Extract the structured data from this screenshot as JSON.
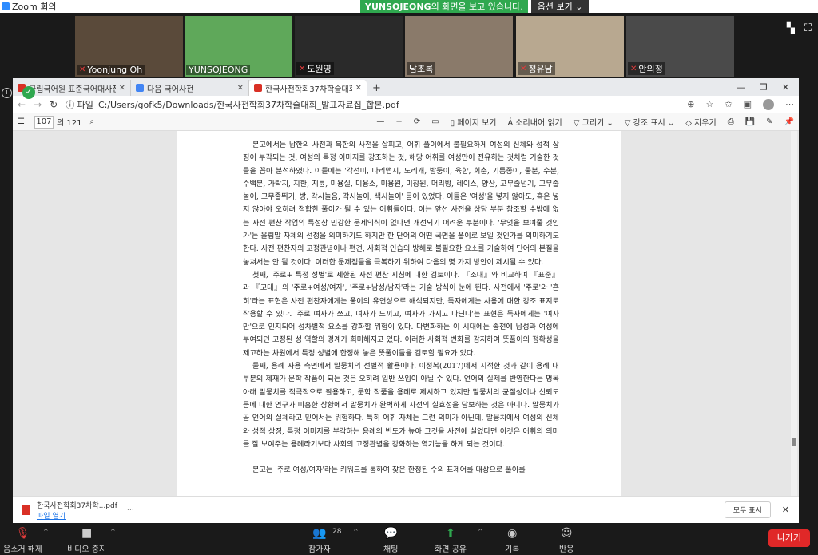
{
  "zoom_window": {
    "title": "Zoom 회의"
  },
  "share_banner": {
    "sharer": "YUNSOJEONG",
    "suffix": "의 화면을 보고 있습니다.",
    "view_options": "옵션 보기 ⌄"
  },
  "participants": [
    {
      "name": "Yoonjung Oh",
      "muted": true,
      "bg": "#5a4a3a"
    },
    {
      "name": "YUNSOJEONG",
      "muted": false,
      "bg": "#5fa85a"
    },
    {
      "name": "도원영",
      "muted": true,
      "bg": "#2a2a2a"
    },
    {
      "name": "남초록",
      "muted": false,
      "bg": "#8a7a6a"
    },
    {
      "name": "정유남",
      "muted": true,
      "bg": "#b8a890"
    },
    {
      "name": "안의정",
      "muted": true,
      "bg": "#4a4a4a"
    }
  ],
  "browser": {
    "tabs": [
      {
        "label": "국립국어원 표준국어대사전",
        "favicon_color": "#d93025"
      },
      {
        "label": "다음 국어사전",
        "favicon_color": "#4285f4"
      },
      {
        "label": "한국사전학회37차학술대회_발표...",
        "favicon_color": "#d93025",
        "active": true
      }
    ],
    "new_tab": "+",
    "window_controls": {
      "minimize": "—",
      "maximize": "❐",
      "close": "✕"
    },
    "address": {
      "prefix": "ⓘ 파일",
      "url": "C:/Users/gofk5/Downloads/한국사전학회37차학술대회_발표자료집_합본.pdf"
    }
  },
  "pdf_toolbar": {
    "page_current": "107",
    "page_total": "의 121",
    "zoom_out": "—",
    "zoom_in": "+",
    "page_view": "페이지 보기",
    "read_aloud": "소리내어 읽기",
    "draw": "그리기",
    "highlight": "강조 표시",
    "erase": "지우기"
  },
  "pdf_text": {
    "paragraphs": [
      "본고에서는 남한의 사전과 북한의 사전을 살피고, 어휘 풀이에서 불필요하게 여성의 신체와 성적 상징이 부각되는 것, 여성의 특정 이미지를 강조하는 것, 해당 어휘를 여성만이 전유하는 것처럼 기술한 것들을 꼽아 분석하였다. 이들에는 '각선미, 다리맵시, 노리개, 방둥이, 육향, 회춘, 기름종이, 물분, 수분, 수백분, 가락지, 지환, 지륜, 미용실, 미용소, 미용원, 미장원, 머리방, 레이스, 양산, 고무줄넘기, 고무줄놀이, 고무줄뛰기, 방, 각시놀음, 각시놀이, 색시놀이' 등이 있었다. 이들은 '여성'을 넣지 않아도, 혹은 넣지 않아야 오히려 적합한 풀이가 될 수 있는 어휘들이다. 이는 앞선 사전을 상당 부분 참조할 수밖에 없는 사전 편찬 작업의 특성상 민감한 문제의식이 없다면 개선되기 어려운 부분이다. '무엇을 보여줄 것인가'는 올림말 자체의 선정을 의미하기도 하지만 한 단어의 어떤 국면을 풀이로 보일 것인가를 의미하기도 한다. 사전 편찬자의 고정관념이나 편견, 사회적 인습의 방해로 불필요한 요소를 기술하여 단어의 본질을 놓쳐서는 안 될 것이다. 이러한 문제점들을 극복하기 위하여 다음의 몇 가지 방안이 제시될 수 있다.",
      "첫째, '주로+ 특정 성별'로 제한된 사전 편찬 지침에 대한 검토이다. 『조대』와 비교하여 『표준』과 『고대』의 '주로+여성/여자', '주로+남성/남자'라는 기술 방식이 눈에 띈다. 사전에서 '주로'와 '흔히'라는 표현은 사전 편찬자에게는 풀이의 유연성으로 해석되지만, 독자에게는 사용에 대한 강조 표지로 작용할 수 있다. '주로 여자가 쓰고, 여자가 느끼고, 여자가 가지고 다닌다'는 표현은 독자에게는 '여자만'으로 인지되어 성차별적 요소를 강화할 위험이 있다. 다변화하는 이 시대에는 종전에 남성과 여성에 부여되던 고정된 성 역할의 경계가 희미해지고 있다. 이러한 사회적 변화를 감지하여 뜻풀이의 정확성을 제고하는 차원에서 특정 성별에 한정해 놓은 뜻풀이들을 검토할 필요가 있다.",
      "둘째, 용례 사용 측면에서 말뭉치의 선별적 활용이다. 이정복(2017)에서 지적한 것과 같이 용례 대부분의 제재가 문학 작품이 되는 것은 오히려 일반 쓰임이 아닐 수 있다. 언어의 실제를 반영한다는 명목 아래 말뭉치를 적극적으로 활용하고, 문학 작품을 용례로 제시하고 있지만 말뭉치의 균질성이나 신뢰도 등에 대한 연구가 미흡한 상황에서 말뭉치가 완벽하게 사전의 실효성을 담보하는 것은 아니다. 말뭉치가 곧 언어의 실체라고 믿어서는 위험하다. 특히 어휘 자체는 그런 의미가 아닌데, 말뭉치에서 여성의 신체와 성적 상징, 특정 이미지를 부각하는 용례의 빈도가 높아 그것을 사전에 실었다면 이것은 어휘의 의미를 잘 보여주는 용례라기보다 사회의 고정관념을 강화하는 역기능을 하게 되는 것이다.",
      "본고는 '주로 여성/여자'라는 키워드를 통하여 찾은 한정된 수의 표제어를 대상으로 풀이를"
    ]
  },
  "download": {
    "filename": "한국사전학회37차학...pdf",
    "open_label": "파일 열기",
    "show_all": "모두 표시"
  },
  "zoom_toolbar": {
    "mute": "음소거 해제",
    "video": "비디오 중지",
    "participants": "참가자",
    "participant_count": "28",
    "chat": "채팅",
    "share": "화면 공유",
    "record": "기록",
    "reactions": "반응",
    "leave": "나가기"
  }
}
